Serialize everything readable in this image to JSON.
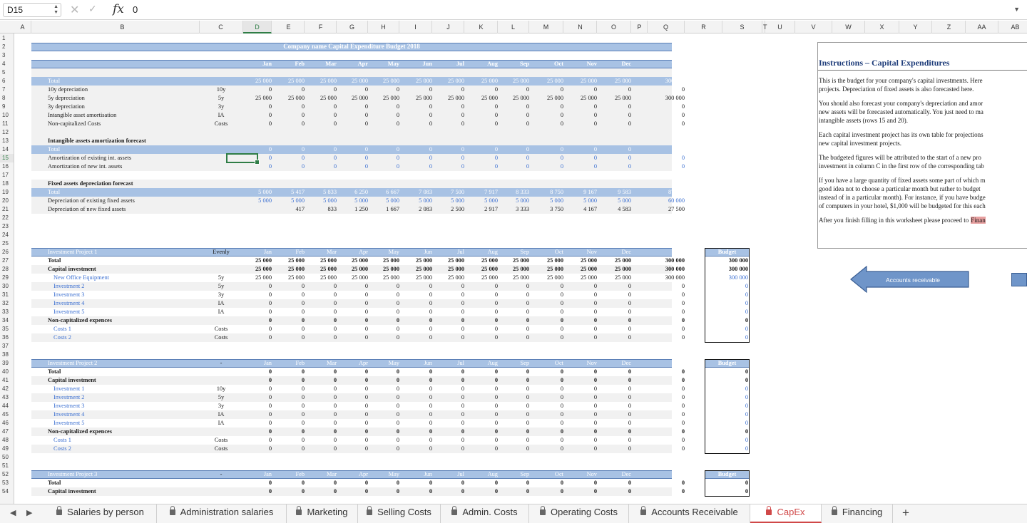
{
  "formula_bar": {
    "cell_ref": "D15",
    "formula": "0",
    "fx_label": "fx"
  },
  "columns": [
    "A",
    "B",
    "C",
    "D",
    "E",
    "F",
    "G",
    "H",
    "I",
    "J",
    "K",
    "L",
    "M",
    "N",
    "O",
    "P",
    "Q",
    "R",
    "S",
    "T",
    "U",
    "V",
    "W",
    "X",
    "Y",
    "Z",
    "AA",
    "AB",
    "AC"
  ],
  "selected_column": "D",
  "selected_row": "15",
  "rows": [
    "1",
    "2",
    "3",
    "4",
    "5",
    "6",
    "7",
    "8",
    "9",
    "10",
    "11",
    "12",
    "13",
    "14",
    "15",
    "16",
    "17",
    "18",
    "19",
    "20",
    "21",
    "22",
    "23",
    "24",
    "25",
    "26",
    "27",
    "28",
    "29",
    "30",
    "31",
    "32",
    "33",
    "34",
    "35",
    "36",
    "37",
    "38",
    "39",
    "40",
    "41",
    "42",
    "43",
    "44",
    "45",
    "46",
    "47",
    "48",
    "49",
    "50",
    "51",
    "52",
    "53",
    "54"
  ],
  "sheet": {
    "title": "Company name Capital Expenditure Budget 2018",
    "months": [
      "Jan",
      "Feb",
      "Mar",
      "Apr",
      "May",
      "Jun",
      "Jul",
      "Aug",
      "Sep",
      "Oct",
      "Nov",
      "Dec",
      "Total"
    ],
    "summary": [
      {
        "label": "Total",
        "code": "",
        "vals": [
          "25 000",
          "25 000",
          "25 000",
          "25 000",
          "25 000",
          "25 000",
          "25 000",
          "25 000",
          "25 000",
          "25 000",
          "25 000",
          "25 000",
          "300 000"
        ]
      },
      {
        "label": "10y depreciation",
        "code": "10y",
        "vals": [
          "0",
          "0",
          "0",
          "0",
          "0",
          "0",
          "0",
          "0",
          "0",
          "0",
          "0",
          "0",
          "0"
        ]
      },
      {
        "label": "5y depreciation",
        "code": "5y",
        "vals": [
          "25 000",
          "25 000",
          "25 000",
          "25 000",
          "25 000",
          "25 000",
          "25 000",
          "25 000",
          "25 000",
          "25 000",
          "25 000",
          "25 000",
          "300 000"
        ]
      },
      {
        "label": "3y depreciation",
        "code": "3y",
        "vals": [
          "0",
          "0",
          "0",
          "0",
          "0",
          "0",
          "0",
          "0",
          "0",
          "0",
          "0",
          "0",
          "0"
        ]
      },
      {
        "label": "Intangible asset amortisation",
        "code": "IA",
        "vals": [
          "0",
          "0",
          "0",
          "0",
          "0",
          "0",
          "0",
          "0",
          "0",
          "0",
          "0",
          "0",
          "0"
        ]
      },
      {
        "label": "Non-capitalized Costs",
        "code": "Costs",
        "vals": [
          "0",
          "0",
          "0",
          "0",
          "0",
          "0",
          "0",
          "0",
          "0",
          "0",
          "0",
          "0",
          "0"
        ]
      }
    ],
    "amort_title": "Intangible assets amortization forecast",
    "amort": [
      {
        "label": "Total",
        "vals": [
          "0",
          "0",
          "0",
          "0",
          "0",
          "0",
          "0",
          "0",
          "0",
          "0",
          "0",
          "0",
          "0"
        ]
      },
      {
        "label": "Amortization of existing int. assets",
        "vals": [
          "0",
          "0",
          "0",
          "0",
          "0",
          "0",
          "0",
          "0",
          "0",
          "0",
          "0",
          "0",
          "0"
        ]
      },
      {
        "label": "Amortization of new int. assets",
        "vals": [
          "0",
          "0",
          "0",
          "0",
          "0",
          "0",
          "0",
          "0",
          "0",
          "0",
          "0",
          "0",
          "0"
        ]
      }
    ],
    "dep_title": "Fixed assets depreciation forecast",
    "dep": [
      {
        "label": "Total",
        "vals": [
          "5 000",
          "5 417",
          "5 833",
          "6 250",
          "6 667",
          "7 083",
          "7 500",
          "7 917",
          "8 333",
          "8 750",
          "9 167",
          "9 583",
          "87 500"
        ]
      },
      {
        "label": "Depreciation of existing fixed assets",
        "vals": [
          "5 000",
          "5 000",
          "5 000",
          "5 000",
          "5 000",
          "5 000",
          "5 000",
          "5 000",
          "5 000",
          "5 000",
          "5 000",
          "5 000",
          "60 000"
        ]
      },
      {
        "label": "Depreciation of new fixed assets",
        "vals": [
          "",
          "417",
          "833",
          "1 250",
          "1 667",
          "2 083",
          "2 500",
          "2 917",
          "3 333",
          "3 750",
          "4 167",
          "4 583",
          "27 500"
        ]
      }
    ],
    "budget_label": "Budget",
    "projects": [
      {
        "name": "Investment Project 1",
        "mode": "Evenly",
        "rows": [
          {
            "label": "Total",
            "code": "",
            "vals": [
              "25 000",
              "25 000",
              "25 000",
              "25 000",
              "25 000",
              "25 000",
              "25 000",
              "25 000",
              "25 000",
              "25 000",
              "25 000",
              "25 000",
              "300 000"
            ],
            "budget": "300 000"
          },
          {
            "label": "Capital investment",
            "code": "",
            "vals": [
              "25 000",
              "25 000",
              "25 000",
              "25 000",
              "25 000",
              "25 000",
              "25 000",
              "25 000",
              "25 000",
              "25 000",
              "25 000",
              "25 000",
              "300 000"
            ],
            "budget": "300 000"
          },
          {
            "label": "New Office Equipment",
            "code": "5y",
            "vals": [
              "25 000",
              "25 000",
              "25 000",
              "25 000",
              "25 000",
              "25 000",
              "25 000",
              "25 000",
              "25 000",
              "25 000",
              "25 000",
              "25 000",
              "300 000"
            ],
            "budget": "300 000"
          },
          {
            "label": "Investment 2",
            "code": "5y",
            "vals": [
              "0",
              "0",
              "0",
              "0",
              "0",
              "0",
              "0",
              "0",
              "0",
              "0",
              "0",
              "0",
              "0"
            ],
            "budget": "0"
          },
          {
            "label": "Investment 3",
            "code": "3y",
            "vals": [
              "0",
              "0",
              "0",
              "0",
              "0",
              "0",
              "0",
              "0",
              "0",
              "0",
              "0",
              "0",
              "0"
            ],
            "budget": "0"
          },
          {
            "label": "Investment 4",
            "code": "IA",
            "vals": [
              "0",
              "0",
              "0",
              "0",
              "0",
              "0",
              "0",
              "0",
              "0",
              "0",
              "0",
              "0",
              "0"
            ],
            "budget": "0"
          },
          {
            "label": "Investment 5",
            "code": "IA",
            "vals": [
              "0",
              "0",
              "0",
              "0",
              "0",
              "0",
              "0",
              "0",
              "0",
              "0",
              "0",
              "0",
              "0"
            ],
            "budget": "0"
          },
          {
            "label": "Non-capitalized expences",
            "code": "",
            "vals": [
              "0",
              "0",
              "0",
              "0",
              "0",
              "0",
              "0",
              "0",
              "0",
              "0",
              "0",
              "0",
              "0"
            ],
            "budget": "0"
          },
          {
            "label": "Costs 1",
            "code": "Costs",
            "vals": [
              "0",
              "0",
              "0",
              "0",
              "0",
              "0",
              "0",
              "0",
              "0",
              "0",
              "0",
              "0",
              "0"
            ],
            "budget": "0"
          },
          {
            "label": "Costs 2",
            "code": "Costs",
            "vals": [
              "0",
              "0",
              "0",
              "0",
              "0",
              "0",
              "0",
              "0",
              "0",
              "0",
              "0",
              "0",
              "0"
            ],
            "budget": "0"
          }
        ]
      },
      {
        "name": "Investment Project 2",
        "mode": "-",
        "rows": [
          {
            "label": "Total",
            "code": "",
            "vals": [
              "0",
              "0",
              "0",
              "0",
              "0",
              "0",
              "0",
              "0",
              "0",
              "0",
              "0",
              "0",
              "0"
            ],
            "budget": "0"
          },
          {
            "label": "Capital investment",
            "code": "",
            "vals": [
              "0",
              "0",
              "0",
              "0",
              "0",
              "0",
              "0",
              "0",
              "0",
              "0",
              "0",
              "0",
              "0"
            ],
            "budget": "0"
          },
          {
            "label": "Investment 1",
            "code": "10y",
            "vals": [
              "0",
              "0",
              "0",
              "0",
              "0",
              "0",
              "0",
              "0",
              "0",
              "0",
              "0",
              "0",
              "0"
            ],
            "budget": "0"
          },
          {
            "label": "Investment 2",
            "code": "5y",
            "vals": [
              "0",
              "0",
              "0",
              "0",
              "0",
              "0",
              "0",
              "0",
              "0",
              "0",
              "0",
              "0",
              "0"
            ],
            "budget": "0"
          },
          {
            "label": "Investment 3",
            "code": "3y",
            "vals": [
              "0",
              "0",
              "0",
              "0",
              "0",
              "0",
              "0",
              "0",
              "0",
              "0",
              "0",
              "0",
              "0"
            ],
            "budget": "0"
          },
          {
            "label": "Investment 4",
            "code": "IA",
            "vals": [
              "0",
              "0",
              "0",
              "0",
              "0",
              "0",
              "0",
              "0",
              "0",
              "0",
              "0",
              "0",
              "0"
            ],
            "budget": "0"
          },
          {
            "label": "Investment 5",
            "code": "IA",
            "vals": [
              "0",
              "0",
              "0",
              "0",
              "0",
              "0",
              "0",
              "0",
              "0",
              "0",
              "0",
              "0",
              "0"
            ],
            "budget": "0"
          },
          {
            "label": "Non-capitalized expences",
            "code": "",
            "vals": [
              "0",
              "0",
              "0",
              "0",
              "0",
              "0",
              "0",
              "0",
              "0",
              "0",
              "0",
              "0",
              "0"
            ],
            "budget": "0"
          },
          {
            "label": "Costs 1",
            "code": "Costs",
            "vals": [
              "0",
              "0",
              "0",
              "0",
              "0",
              "0",
              "0",
              "0",
              "0",
              "0",
              "0",
              "0",
              "0"
            ],
            "budget": "0"
          },
          {
            "label": "Costs 2",
            "code": "Costs",
            "vals": [
              "0",
              "0",
              "0",
              "0",
              "0",
              "0",
              "0",
              "0",
              "0",
              "0",
              "0",
              "0",
              "0"
            ],
            "budget": "0"
          }
        ]
      },
      {
        "name": "Investment Project 3",
        "mode": "-",
        "rows": [
          {
            "label": "Total",
            "code": "",
            "vals": [
              "0",
              "0",
              "0",
              "0",
              "0",
              "0",
              "0",
              "0",
              "0",
              "0",
              "0",
              "0",
              "0"
            ],
            "budget": "0"
          },
          {
            "label": "Capital investment",
            "code": "",
            "vals": [
              "0",
              "0",
              "0",
              "0",
              "0",
              "0",
              "0",
              "0",
              "0",
              "0",
              "0",
              "0",
              "0"
            ],
            "budget": "0"
          }
        ]
      }
    ]
  },
  "instructions": {
    "title": "Instructions – Capital Expenditures",
    "lines": [
      "This is the budget for your company's capital investments. Here",
      "projects. Depreciation of fixed assets is also forecasted here.",
      "",
      "You should also forecast your company's depreciation and amor",
      "new assets will be forecasted automatically. You just need to ma",
      "intangible assets (rows 15 and 20).",
      "",
      "Each capital investment project has its own table for projections",
      "new capital investment projects.",
      "",
      "The budgeted figures will be attributed to the start of a new pro",
      "investment in column C in the first row of the corresponding tab",
      "",
      "If you have a large quantity of fixed assets some part of which m",
      "good idea not to choose a particular month but rather to budget",
      "instead of in a particular month). For instance, if you have budge",
      "of computers in your hotel, $1,000 will be budgeted for this each",
      "",
      "After you finish filling in this worksheet please proceed to"
    ],
    "link_text": "Finan"
  },
  "nav_button": {
    "label": "Accounts receivable"
  },
  "tabs": [
    {
      "label": "Salaries by person",
      "active": false
    },
    {
      "label": "Administration salaries",
      "active": false
    },
    {
      "label": "Marketing",
      "active": false
    },
    {
      "label": "Selling Costs",
      "active": false
    },
    {
      "label": "Admin. Costs",
      "active": false
    },
    {
      "label": "Operating Costs",
      "active": false
    },
    {
      "label": "Accounts Receivable",
      "active": false
    },
    {
      "label": "CapEx",
      "active": true
    },
    {
      "label": "Financing",
      "active": false
    }
  ],
  "add_tab": "+",
  "nav_prev": "◀",
  "nav_next": "▶",
  "colors": {
    "band": "#a8c2e4",
    "link_blue": "#3b6fd1",
    "active_tab": "#d04848",
    "select_green": "#2f7d46"
  }
}
